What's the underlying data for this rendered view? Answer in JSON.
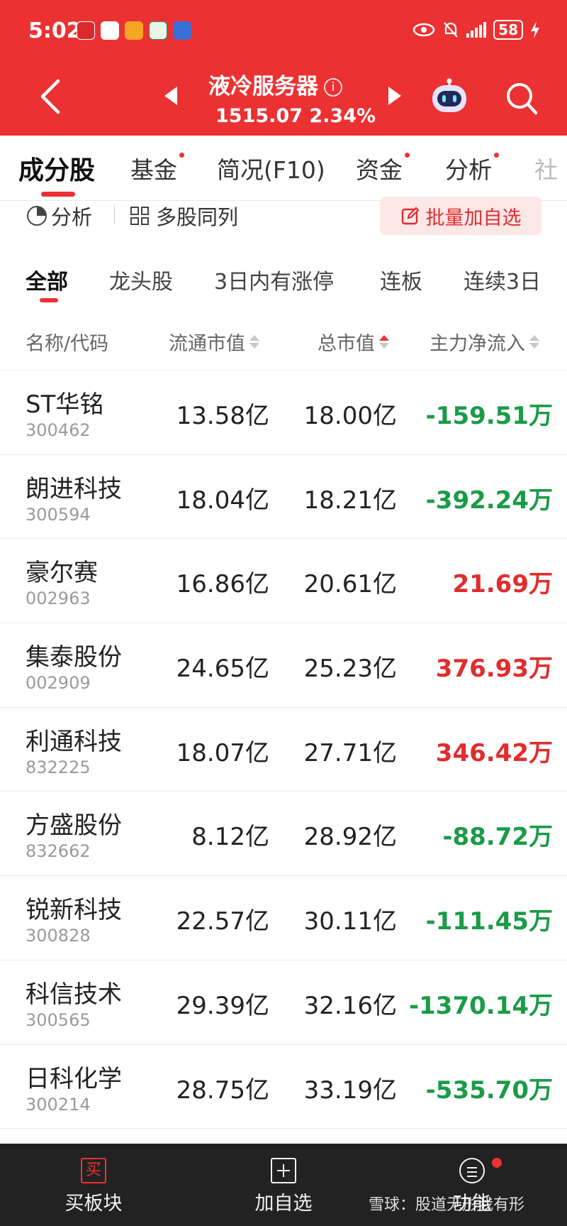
{
  "status_bar": {
    "time": "5:02",
    "battery": "58"
  },
  "header": {
    "title": "液冷服务器",
    "info_glyph": "i",
    "quote": "1515.07 2.34%"
  },
  "tabs": [
    {
      "label": "成分股",
      "dot": false
    },
    {
      "label": "基金",
      "dot": true
    },
    {
      "label": "简况(F10)",
      "dot": false
    },
    {
      "label": "资金",
      "dot": true
    },
    {
      "label": "分析",
      "dot": true
    },
    {
      "label": "社",
      "dot": false
    }
  ],
  "toolbar": {
    "analysis": "分析",
    "multi": "多股同列",
    "batch_add": "批量加自选"
  },
  "filters": [
    "全部",
    "龙头股",
    "3日内有涨停",
    "连板",
    "连续3日"
  ],
  "table": {
    "columns": [
      "名称/代码",
      "流通市值",
      "总市值",
      "主力净流入"
    ],
    "rows": [
      {
        "name": "ST华铭",
        "code": "300462",
        "float_cap": "13.58亿",
        "total_cap": "18.00亿",
        "net_inflow": "-159.51万"
      },
      {
        "name": "朗进科技",
        "code": "300594",
        "float_cap": "18.04亿",
        "total_cap": "18.21亿",
        "net_inflow": "-392.24万"
      },
      {
        "name": "豪尔赛",
        "code": "002963",
        "float_cap": "16.86亿",
        "total_cap": "20.61亿",
        "net_inflow": "21.69万"
      },
      {
        "name": "集泰股份",
        "code": "002909",
        "float_cap": "24.65亿",
        "total_cap": "25.23亿",
        "net_inflow": "376.93万"
      },
      {
        "name": "利通科技",
        "code": "832225",
        "float_cap": "18.07亿",
        "total_cap": "27.71亿",
        "net_inflow": "346.42万"
      },
      {
        "name": "方盛股份",
        "code": "832662",
        "float_cap": "8.12亿",
        "total_cap": "28.92亿",
        "net_inflow": "-88.72万"
      },
      {
        "name": "锐新科技",
        "code": "300828",
        "float_cap": "22.57亿",
        "total_cap": "30.11亿",
        "net_inflow": "-111.45万"
      },
      {
        "name": "科信技术",
        "code": "300565",
        "float_cap": "29.39亿",
        "total_cap": "32.16亿",
        "net_inflow": "-1370.14万"
      },
      {
        "name": "日科化学",
        "code": "300214",
        "float_cap": "28.75亿",
        "total_cap": "33.19亿",
        "net_inflow": "-535.70万"
      }
    ]
  },
  "bottom_bar": {
    "buy_icon_glyph": "买",
    "buy": "买板块",
    "add": "加自选",
    "func": "功能",
    "watermark": "雪球：股道无形我有形"
  },
  "colors": {
    "brand_red": "#ec3132",
    "negative_green": "#1b9b47",
    "positive_red": "#e02d2e"
  }
}
